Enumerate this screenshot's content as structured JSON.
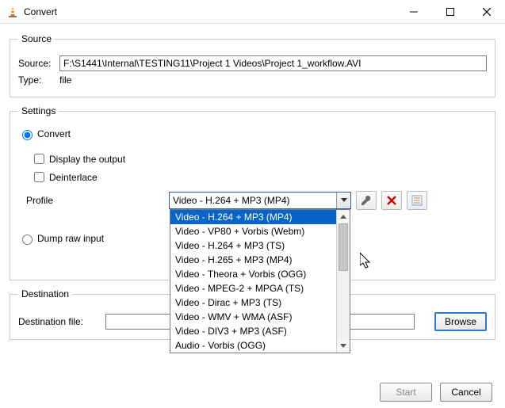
{
  "window": {
    "title": "Convert"
  },
  "source": {
    "legend": "Source",
    "label": "Source:",
    "value": "F:\\S1441\\Internal\\TESTING11\\Project 1 Videos\\Project 1_workflow.AVI",
    "type_label": "Type:",
    "type_value": "file"
  },
  "settings": {
    "legend": "Settings",
    "convert_label": "Convert",
    "display_output_label": "Display the output",
    "deinterlace_label": "Deinterlace",
    "profile_label": "Profile",
    "profile_selected": "Video - H.264 + MP3 (MP4)",
    "profile_options": [
      "Video - H.264 + MP3 (MP4)",
      "Video - VP80 + Vorbis (Webm)",
      "Video - H.264 + MP3 (TS)",
      "Video - H.265 + MP3 (MP4)",
      "Video - Theora + Vorbis (OGG)",
      "Video - MPEG-2 + MPGA (TS)",
      "Video - Dirac + MP3 (TS)",
      "Video - WMV + WMA (ASF)",
      "Video - DIV3 + MP3 (ASF)",
      "Audio - Vorbis (OGG)"
    ],
    "dump_label": "Dump raw input"
  },
  "destination": {
    "legend": "Destination",
    "file_label": "Destination file:",
    "value": "",
    "browse_label": "Browse"
  },
  "footer": {
    "start_label": "Start",
    "cancel_label": "Cancel"
  },
  "icons": {
    "wrench": "wrench-icon",
    "delete": "delete-icon",
    "new": "new-profile-icon"
  }
}
